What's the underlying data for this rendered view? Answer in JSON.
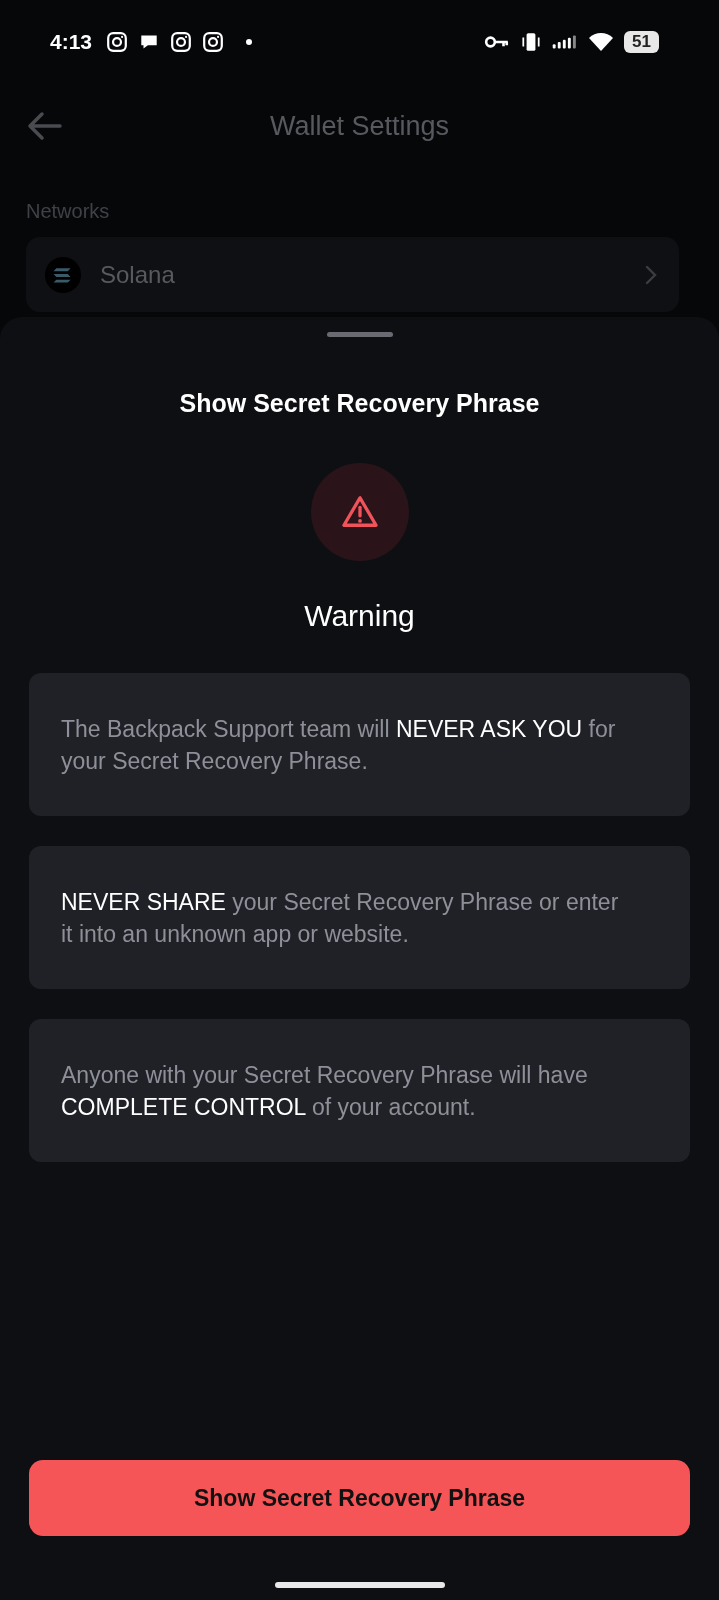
{
  "status_bar": {
    "time": "4:13",
    "battery": "51"
  },
  "header": {
    "title": "Wallet Settings"
  },
  "networks": {
    "label": "Networks",
    "items": [
      {
        "name": "Solana"
      }
    ]
  },
  "sheet": {
    "title": "Show Secret Recovery Phrase",
    "heading": "Warning",
    "warnings": [
      {
        "text": "The Backpack Support team will **NEVER ASK YOU** for your Secret Recovery Phrase."
      },
      {
        "text": "**NEVER SHARE** your Secret Recovery Phrase or enter it into an unknown app or website."
      },
      {
        "text": "Anyone with your Secret Recovery Phrase will have **COMPLETE CONTROL** of your account."
      }
    ],
    "button": "Show Secret Recovery Phrase"
  }
}
